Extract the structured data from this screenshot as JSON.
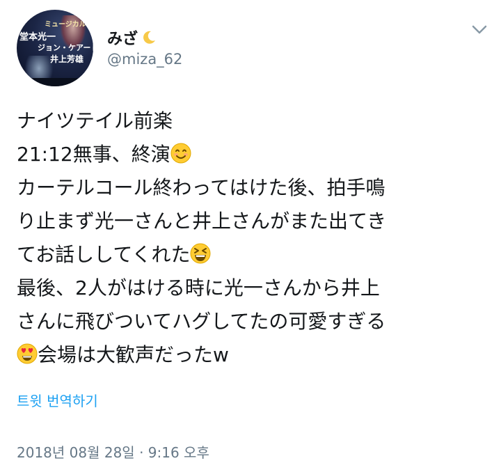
{
  "user": {
    "display_name": "みざ",
    "name_emoji": "crescent-moon-icon",
    "handle": "@miza_62",
    "avatar_text": {
      "line1": "ミュージカルの",
      "line2": "堂本光一",
      "line3": "ジョン・ケアード",
      "line4": "井上芳雄"
    }
  },
  "tweet": {
    "lines": {
      "l1": "ナイツテイル前楽",
      "l2": "21:12無事、終演",
      "l3": "カーテルコール終わってはけた後、拍手鳴",
      "l4": "り止まず光一さんと井上さんがまた出てき",
      "l5": "てお話ししてくれた",
      "l6": "最後、2人がはける時に光一さんから井上",
      "l7": "さんに飛びついてハグしてたの可愛すぎる",
      "l8": "会場は大歓声だったw"
    },
    "emojis": [
      "smiling-face-icon",
      "grinning-squinting-face-icon",
      "heart-eyes-face-icon"
    ]
  },
  "actions": {
    "translate": "트윗 번역하기"
  },
  "meta": {
    "timestamp": "2018년 08월 28일 · 9:16 오후"
  },
  "colors": {
    "text": "#14171a",
    "secondary": "#657786",
    "link": "#1da1f2"
  }
}
